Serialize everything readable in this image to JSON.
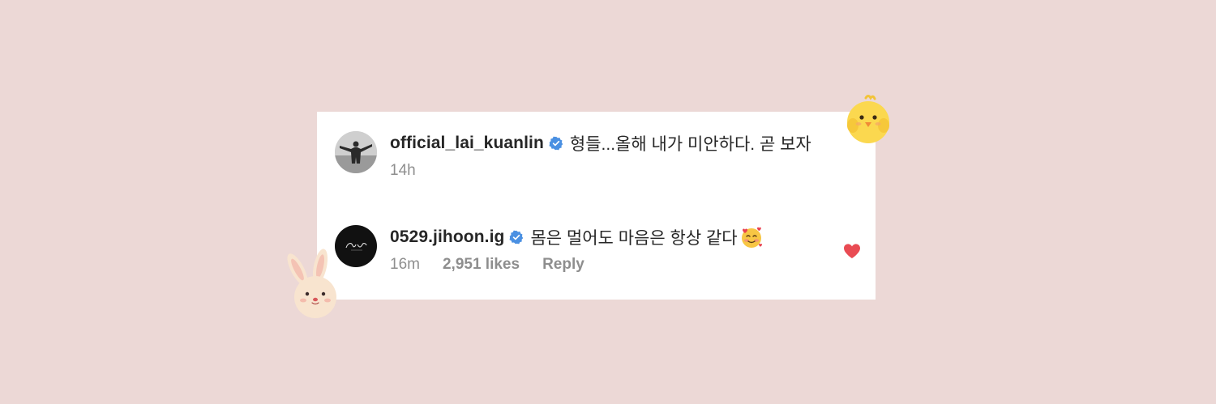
{
  "comments": [
    {
      "username": "official_lai_kuanlin",
      "verified": true,
      "text": "형들...올해 내가 미안하다. 곧 보자",
      "time": "14h"
    },
    {
      "username": "0529.jihoon.ig",
      "verified": true,
      "text": "몸은 멀어도 마음은 항상 같다",
      "emoji": "smiling-face-with-hearts",
      "time": "16m",
      "likes": "2,951 likes",
      "reply_label": "Reply",
      "liked": true
    }
  ],
  "colors": {
    "background": "#ecd8d6",
    "card": "#ffffff",
    "verified": "#4a90e2",
    "heart": "#e94b53",
    "meta": "#8e8e8e"
  },
  "stickers": [
    "chick-sticker",
    "bunny-sticker"
  ]
}
